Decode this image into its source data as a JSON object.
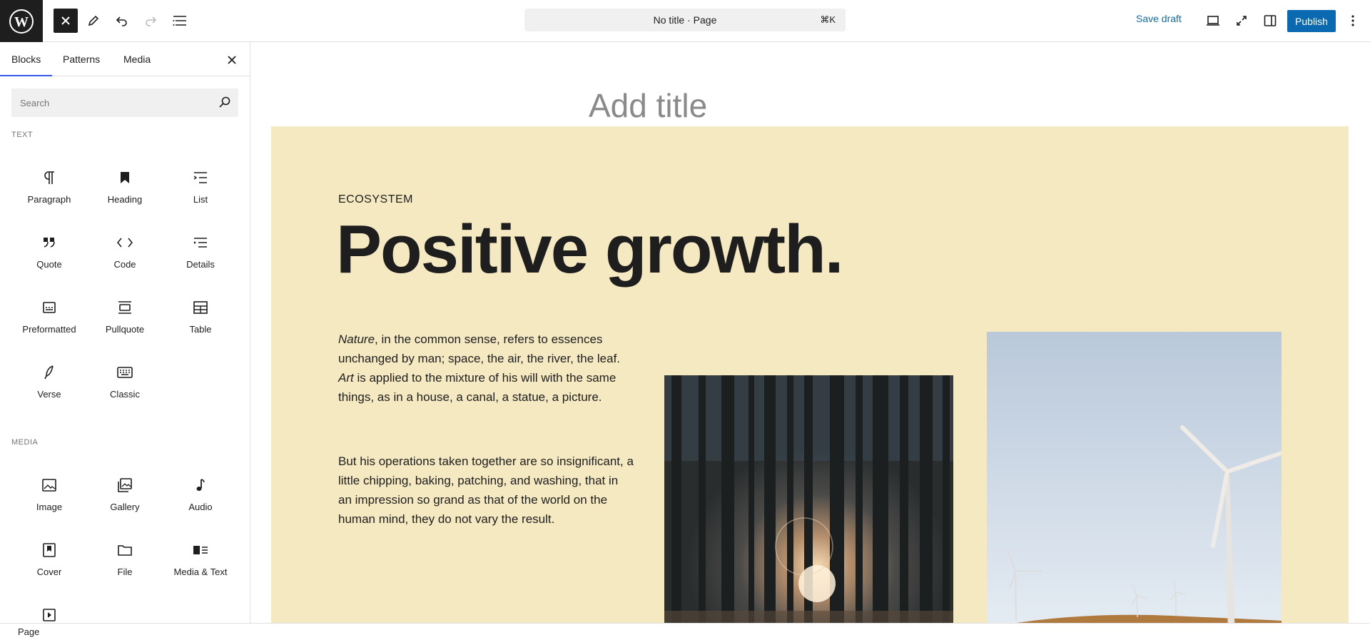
{
  "topbar": {
    "command_title": "No title · Page",
    "command_shortcut": "⌘K",
    "save_draft": "Save draft",
    "publish": "Publish"
  },
  "inserter": {
    "tabs": [
      "Blocks",
      "Patterns",
      "Media"
    ],
    "search_placeholder": "Search",
    "categories": {
      "text": {
        "label": "TEXT",
        "blocks": [
          "Paragraph",
          "Heading",
          "List",
          "Quote",
          "Code",
          "Details",
          "Preformatted",
          "Pullquote",
          "Table",
          "Verse",
          "Classic"
        ]
      },
      "media": {
        "label": "MEDIA",
        "blocks": [
          "Image",
          "Gallery",
          "Audio",
          "Cover",
          "File",
          "Media & Text"
        ]
      }
    }
  },
  "editor": {
    "title_placeholder": "Add title",
    "eyebrow": "ECOSYSTEM",
    "headline": "Positive growth.",
    "para1": {
      "em1": "Nature",
      "t1": ", in the common sense, refers to essences unchanged by man; space, the air, the river, the leaf. ",
      "em2": "Art",
      "t2": " is applied to the mixture of his will with the same things, as in a house, a canal, a statue, a picture."
    },
    "para2": "But his operations taken together are so insignificant, a little chipping, baking, patching, and washing, that in an impression so grand as that of the world on the human mind, they do not vary the result.",
    "cover_color": "#f5e9c1"
  },
  "statusbar": {
    "breadcrumb": "Page"
  },
  "colors": {
    "accent": "#3858e9",
    "publish": "#0a69b1",
    "link": "#0b6cab"
  }
}
